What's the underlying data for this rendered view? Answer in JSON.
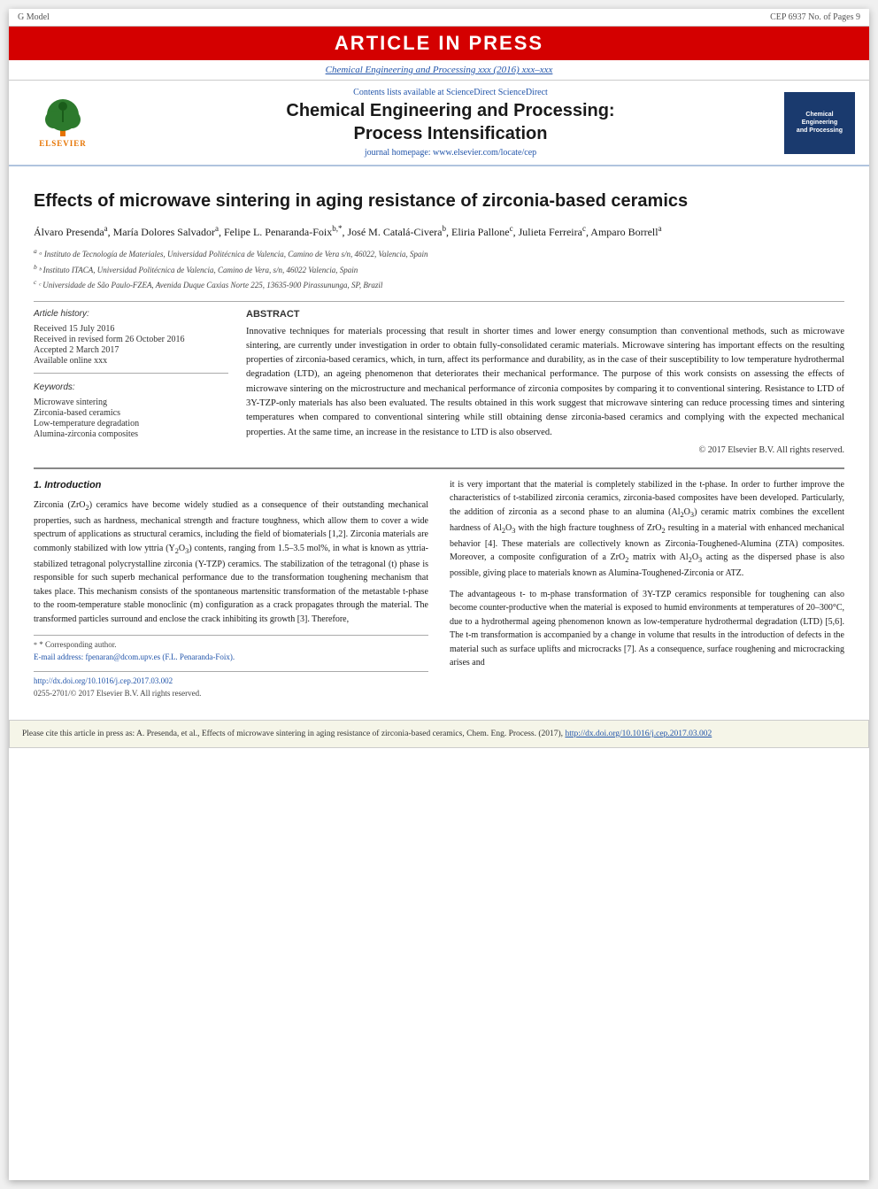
{
  "topBanner": {
    "gModel": "G Model",
    "cep": "CEP 6937 No. of Pages 9"
  },
  "articleInPress": "ARTICLE IN PRESS",
  "journalLinkBar": {
    "text": "Chemical Engineering and Processing xxx (2016) xxx–xxx",
    "url": "Chemical Engineering and Processing xxx (2016) xxx–xxx"
  },
  "header": {
    "contentsLine": "Contents lists available at ScienceDirect",
    "journalTitle": "Chemical Engineering and Processing:",
    "journalSubtitle": "Process Intensification",
    "homepageLabel": "journal homepage:",
    "homepageUrl": "www.elsevier.com/locate/cep",
    "elsevierText": "ELSEVIER"
  },
  "article": {
    "title": "Effects of microwave sintering in aging resistance of zirconia-based ceramics",
    "authors": "Álvaro Presendaᵃ, María Dolores Salvadorᵃ, Felipe L. Penaranda-Foixᵇ,*, José M. Catalá-Civeraᵇ, Eliria Palloneᶜ, Julieta Ferreiraᶜ, Amparo Borrellᵃ",
    "affiliations": [
      "ᵃ Instituto de Tecnología de Materiales, Universidad Politécnica de Valencia, Camino de Vera s/n, 46022, Valencia, Spain",
      "ᵇ Instituto ITACA, Universidad Politécnica de Valencia, Camino de Vera, s/n, 46022 Valencia, Spain",
      "ᶜ Universidade de São Paulo-FZEA, Avenida Duque Caxias Norte 225, 13635-900 Pirassununga, SP, Brazil"
    ]
  },
  "articleInfo": {
    "header": "Article history:",
    "received": "Received 15 July 2016",
    "revisedForm": "Received in revised form 26 October 2016",
    "accepted": "Accepted 2 March 2017",
    "availableOnline": "Available online xxx",
    "keywordsHeader": "Keywords:",
    "keywords": [
      "Microwave sintering",
      "Zirconia-based ceramics",
      "Low-temperature degradation",
      "Alumina-zirconia composites"
    ]
  },
  "abstract": {
    "header": "ABSTRACT",
    "text": "Innovative techniques for materials processing that result in shorter times and lower energy consumption than conventional methods, such as microwave sintering, are currently under investigation in order to obtain fully-consolidated ceramic materials. Microwave sintering has important effects on the resulting properties of zirconia-based ceramics, which, in turn, affect its performance and durability, as in the case of their susceptibility to low temperature hydrothermal degradation (LTD), an ageing phenomenon that deteriorates their mechanical performance. The purpose of this work consists on assessing the effects of microwave sintering on the microstructure and mechanical performance of zirconia composites by comparing it to conventional sintering. Resistance to LTD of 3Y-TZP-only materials has also been evaluated. The results obtained in this work suggest that microwave sintering can reduce processing times and sintering temperatures when compared to conventional sintering while still obtaining dense zirconia-based ceramics and complying with the expected mechanical properties. At the same time, an increase in the resistance to LTD is also observed.",
    "copyright": "© 2017 Elsevier B.V. All rights reserved."
  },
  "introduction": {
    "sectionTitle": "1. Introduction",
    "leftPara1": "Zirconia (ZrO₂) ceramics have become widely studied as a consequence of their outstanding mechanical properties, such as hardness, mechanical strength and fracture toughness, which allow them to cover a wide spectrum of applications as structural ceramics, including the field of biomaterials [1,2]. Zirconia materials are commonly stabilized with low yttria (Y₂O₃) contents, ranging from 1.5–3.5 mol%, in what is known as yttria-stabilized tetragonal polycrystalline zirconia (Y-TZP) ceramics. The stabilization of the tetragonal (t) phase is responsible for such superb mechanical performance due to the transformation toughening mechanism that takes place. This mechanism consists of the spontaneous martensitic transformation of the metastable t-phase to the room-temperature stable monoclinic (m) configuration as a crack propagates through the material. The transformed particles surround and enclose the crack inhibiting its growth [3]. Therefore,",
    "rightPara1": "it is very important that the material is completely stabilized in the t-phase. In order to further improve the characteristics of t-stabilized zirconia ceramics, zirconia-based composites have been developed. Particularly, the addition of zirconia as a second phase to an alumina (Al₂O₃) ceramic matrix combines the excellent hardness of Al₂O₃ with the high fracture toughness of ZrO₂ resulting in a material with enhanced mechanical behavior [4]. These materials are collectively known as Zirconia-Toughened-Alumina (ZTA) composites. Moreover, a composite configuration of a ZrO₂ matrix with Al₂O₃ acting as the dispersed phase is also possible, giving place to materials known as Alumina-Toughened-Zirconia or ATZ.",
    "rightPara2": "The advantageous t- to m-phase transformation of 3Y-TZP ceramics responsible for toughening can also become counter-productive when the material is exposed to humid environments at temperatures of 20–300°C, due to a hydrothermal ageing phenomenon known as low-temperature hydrothermal degradation (LTD) [5,6]. The t-m transformation is accompanied by a change in volume that results in the introduction of defects in the material such as surface uplifts and microcracks [7]. As a consequence, surface roughening and microcracking arises and"
  },
  "footnote": {
    "star": "* Corresponding author.",
    "email": "E-mail address: fpenaran@dcom.upv.es (F.L. Penaranda-Foix)."
  },
  "doi": {
    "url": "http://dx.doi.org/10.1016/j.cep.2017.03.002",
    "issn": "0255-2701/© 2017 Elsevier B.V. All rights reserved."
  },
  "citebar": {
    "text": "Please cite this article in press as: A. Presenda, et al., Effects of microwave sintering in aging resistance of zirconia-based ceramics, Chem. Eng. Process. (2017),",
    "url": "http://dx.doi.org/10.1016/j.cep.2017.03.002"
  }
}
